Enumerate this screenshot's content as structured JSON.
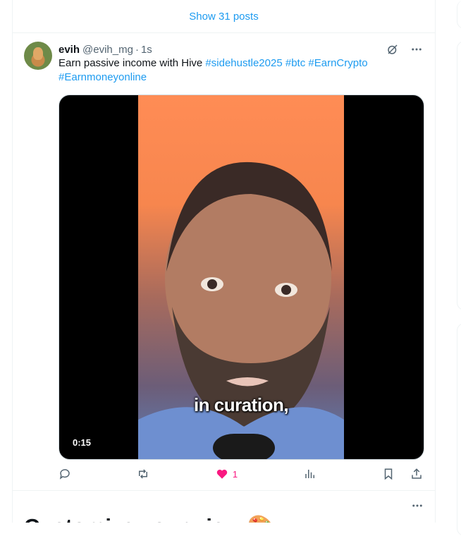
{
  "show_posts": "Show 31 posts",
  "tweet": {
    "name": "evih",
    "handle": "@evih_mg",
    "dot": "·",
    "time": "1s",
    "text_prefix": "Earn passive income with Hive ",
    "hashtags": [
      "#sidehustle2025",
      "#btc",
      "#EarnCrypto",
      "#Earnmoneyonline"
    ],
    "video": {
      "duration": "0:15",
      "caption": "in curation,"
    },
    "actions": {
      "like_count": "1"
    }
  },
  "customize": {
    "title": "Customize your view",
    "emoji": "🎨"
  },
  "colors": {
    "accent": "#1d9bf0",
    "like": "#f91880",
    "muted": "#536471"
  },
  "icons": {
    "header": [
      "grok-icon",
      "more-icon"
    ],
    "actions": [
      "reply-icon",
      "repost-icon",
      "like-icon",
      "views-icon",
      "bookmark-icon",
      "share-icon"
    ]
  }
}
